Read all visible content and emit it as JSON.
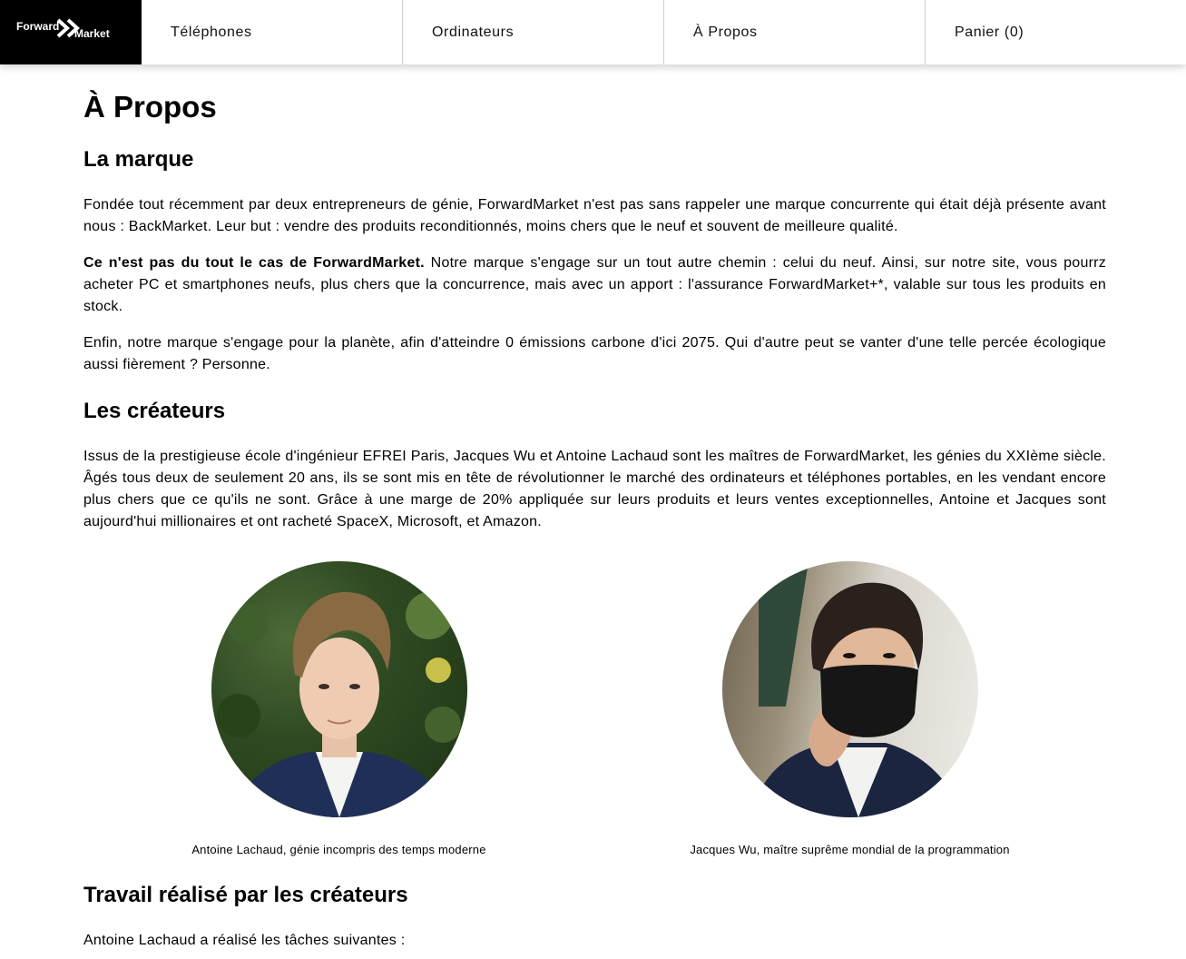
{
  "brand": {
    "word1": "Forward",
    "word2": "Market"
  },
  "nav": [
    {
      "label": "Téléphones"
    },
    {
      "label": "Ordinateurs"
    },
    {
      "label": "À Propos"
    },
    {
      "label": "Panier (0)"
    }
  ],
  "page": {
    "title": "À Propos",
    "sections": {
      "marque": {
        "heading": "La marque",
        "p1": "Fondée tout récemment par deux entrepreneurs de génie, ForwardMarket n'est pas sans rappeler une marque concurrente qui était déjà présente avant nous : BackMarket. Leur but : vendre des produits reconditionnés, moins chers que le neuf et souvent de meilleure qualité.",
        "p2_strong": "Ce n'est pas du tout le cas de ForwardMarket.",
        "p2_rest": " Notre marque s'engage sur un tout autre chemin : celui du neuf. Ainsi, sur notre site, vous pourrz acheter PC et smartphones neufs, plus chers que la concurrence, mais avec un apport : l'assurance ForwardMarket+*, valable sur tous les produits en stock.",
        "p3": "Enfin, notre marque s'engage pour la planète, afin d'atteindre 0 émissions carbone d'ici 2075. Qui d'autre peut se vanter d'une telle percée écologique aussi fièrement ? Personne."
      },
      "createurs": {
        "heading": "Les créateurs",
        "p1": "Issus de la prestigieuse école d'ingénieur EFREI Paris, Jacques Wu et Antoine Lachaud sont les maîtres de ForwardMarket, les génies du XXIème siècle. Âgés tous deux de seulement 20 ans, ils se sont mis en tête de révolutionner le marché des ordinateurs et téléphones portables, en les vendant encore plus chers que ce qu'ils ne sont. Grâce à une marge de 20% appliquée sur leurs produits et leurs ventes exceptionnelles, Antoine et Jacques sont aujourd'hui millionaires et ont racheté SpaceX, Microsoft, et Amazon.",
        "people": [
          {
            "caption": "Antoine Lachaud, génie incompris des temps moderne"
          },
          {
            "caption": "Jacques Wu, maître suprême mondial de la programmation"
          }
        ]
      },
      "travail": {
        "heading": "Travail réalisé par les créateurs",
        "p1": "Antoine Lachaud a réalisé les tâches suivantes :"
      }
    }
  }
}
